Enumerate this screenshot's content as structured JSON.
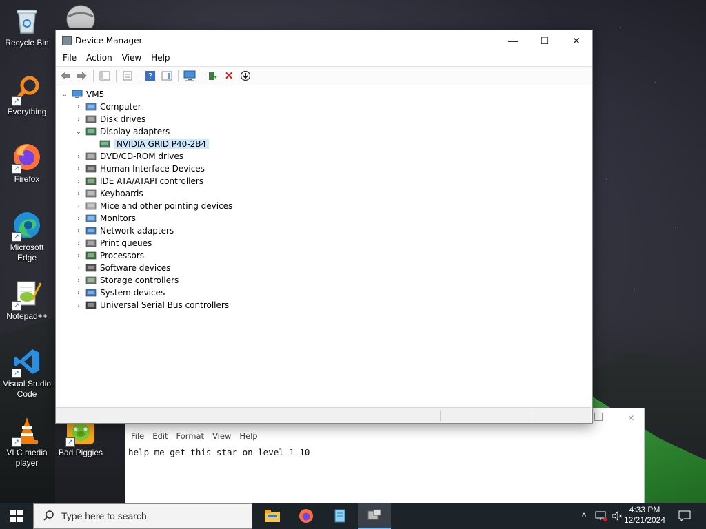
{
  "desktop": {
    "icons": [
      {
        "label": "Recycle Bin"
      },
      {
        "label": "Everything"
      },
      {
        "label": "Firefox"
      },
      {
        "label": "Microsoft Edge"
      },
      {
        "label": "Notepad++"
      },
      {
        "label": "Visual Studio Code"
      },
      {
        "label": "VLC media player"
      },
      {
        "label": "Bad Piggies"
      }
    ]
  },
  "notepad": {
    "menu": [
      "File",
      "Edit",
      "Format",
      "View",
      "Help"
    ],
    "text": "help me get this star on level 1-10",
    "close_icon": "×"
  },
  "device_manager": {
    "title": "Device Manager",
    "menu": [
      "File",
      "Action",
      "View",
      "Help"
    ],
    "window_controls": {
      "minimize": "—",
      "maximize": "☐",
      "close": "✕"
    },
    "tree": {
      "root": "VM5",
      "items": [
        {
          "label": "Computer",
          "expanded": false,
          "icon": "computer-icon"
        },
        {
          "label": "Disk drives",
          "expanded": false,
          "icon": "disk-drive-icon"
        },
        {
          "label": "Display adapters",
          "expanded": true,
          "icon": "display-adapter-icon"
        },
        {
          "label": "NVIDIA GRID P40-2B4",
          "child": true,
          "selected": true,
          "icon": "gpu-icon"
        },
        {
          "label": "DVD/CD-ROM drives",
          "expanded": false,
          "icon": "dvd-icon"
        },
        {
          "label": "Human Interface Devices",
          "expanded": false,
          "icon": "hid-icon"
        },
        {
          "label": "IDE ATA/ATAPI controllers",
          "expanded": false,
          "icon": "ide-controller-icon"
        },
        {
          "label": "Keyboards",
          "expanded": false,
          "icon": "keyboard-icon"
        },
        {
          "label": "Mice and other pointing devices",
          "expanded": false,
          "icon": "mouse-icon"
        },
        {
          "label": "Monitors",
          "expanded": false,
          "icon": "monitor-icon"
        },
        {
          "label": "Network adapters",
          "expanded": false,
          "icon": "network-adapter-icon"
        },
        {
          "label": "Print queues",
          "expanded": false,
          "icon": "printer-icon"
        },
        {
          "label": "Processors",
          "expanded": false,
          "icon": "processor-icon"
        },
        {
          "label": "Software devices",
          "expanded": false,
          "icon": "software-device-icon"
        },
        {
          "label": "Storage controllers",
          "expanded": false,
          "icon": "storage-controller-icon"
        },
        {
          "label": "System devices",
          "expanded": false,
          "icon": "system-device-icon"
        },
        {
          "label": "Universal Serial Bus controllers",
          "expanded": false,
          "icon": "usb-icon"
        }
      ]
    }
  },
  "taskbar": {
    "search_placeholder": "Type here to search",
    "time": "4:33 PM",
    "date": "12/21/2024"
  },
  "colors": {
    "selection": "#cce8ff",
    "taskbar": "#1c2329",
    "accent": "#76b9ed"
  }
}
